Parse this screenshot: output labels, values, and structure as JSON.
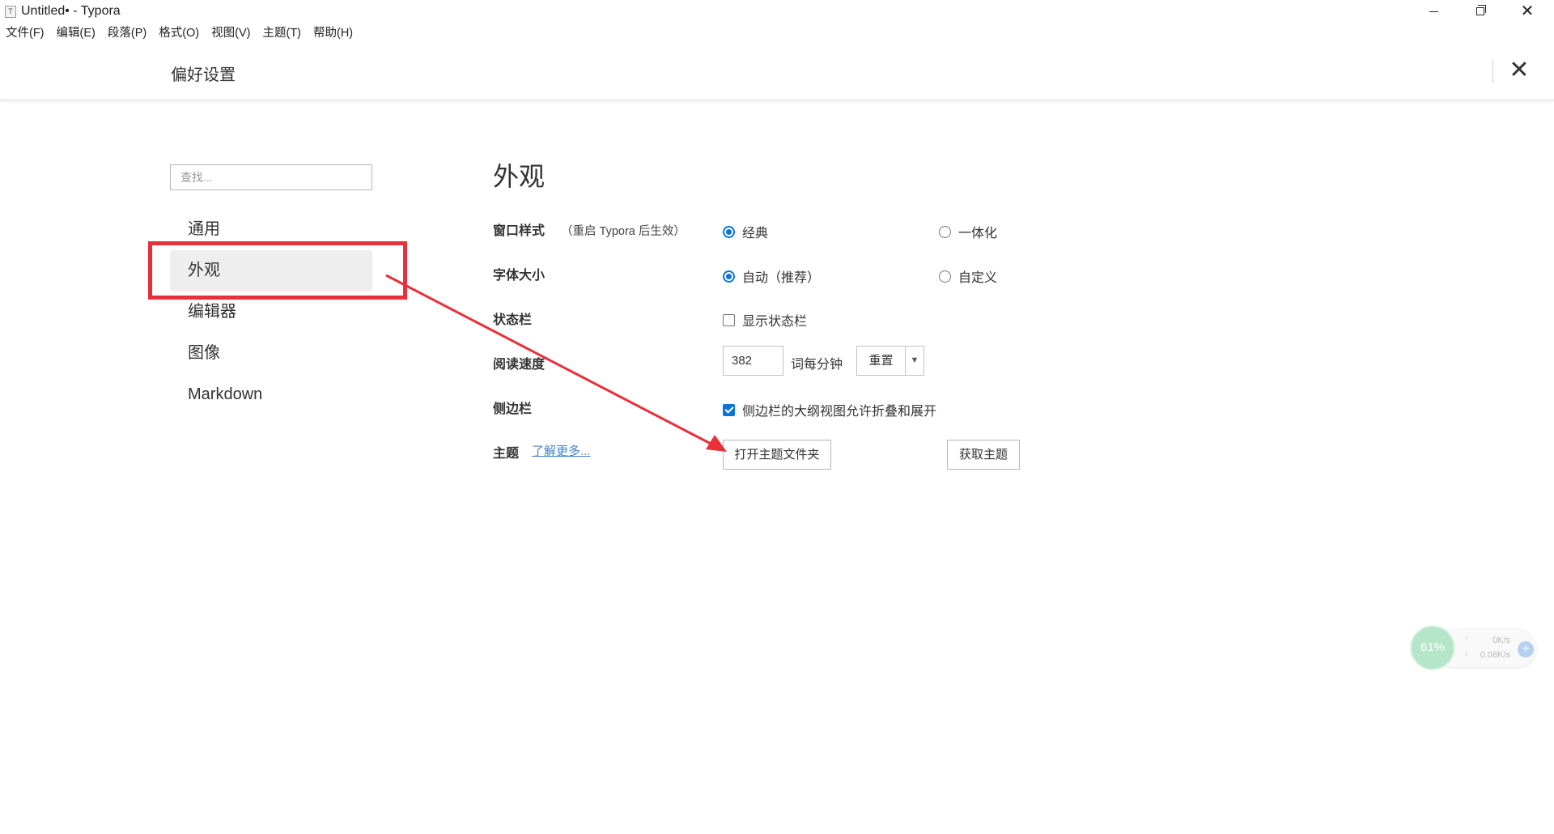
{
  "window": {
    "title": "Untitled• - Typora",
    "app_icon_glyph": "T",
    "controls": {
      "minimize_icon": "minimize-icon",
      "maximize_icon": "restore-icon",
      "close_icon": "close-icon",
      "close_glyph": "✕"
    }
  },
  "menubar": {
    "items": [
      "文件(F)",
      "编辑(E)",
      "段落(P)",
      "格式(O)",
      "视图(V)",
      "主题(T)",
      "帮助(H)"
    ]
  },
  "preferences": {
    "title": "偏好设置",
    "close_glyph": "✕"
  },
  "sidebar": {
    "search_placeholder": "查找...",
    "items": [
      {
        "label": "通用",
        "active": false
      },
      {
        "label": "外观",
        "active": true
      },
      {
        "label": "编辑器",
        "active": false
      },
      {
        "label": "图像",
        "active": false
      },
      {
        "label": "Markdown",
        "active": false
      }
    ]
  },
  "main": {
    "section_title": "外观",
    "window_style": {
      "label": "窗口样式",
      "note": "（重启 Typora 后生效）",
      "options": [
        {
          "label": "经典",
          "selected": true
        },
        {
          "label": "一体化",
          "selected": false
        }
      ]
    },
    "font_size": {
      "label": "字体大小",
      "options": [
        {
          "label": "自动（推荐）",
          "selected": true
        },
        {
          "label": "自定义",
          "selected": false
        }
      ]
    },
    "status_bar": {
      "label": "状态栏",
      "checkbox_label": "显示状态栏",
      "checked": false
    },
    "reading_speed": {
      "label": "阅读速度",
      "value": "382",
      "unit": "词每分钟",
      "reset_label": "重置",
      "dropdown_glyph": "▼"
    },
    "sidebar_setting": {
      "label": "侧边栏",
      "checkbox_label": "侧边栏的大纲视图允许折叠和展开",
      "checked": true
    },
    "theme": {
      "label": "主题",
      "link": "了解更多...",
      "open_folder_button": "打开主题文件夹",
      "get_themes_button": "获取主题"
    }
  },
  "annotation": {
    "color": "#e8303a"
  },
  "network_widget": {
    "percent": "61%",
    "upload": "0K/s",
    "download": "0.08K/s",
    "up_glyph": "↑",
    "down_glyph": "↓",
    "plus_glyph": "+"
  }
}
